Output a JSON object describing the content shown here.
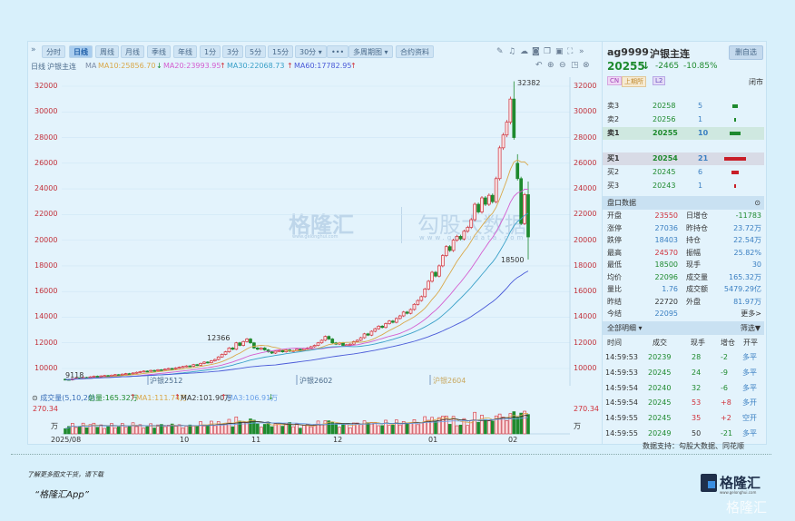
{
  "toolbar": {
    "collapse_icon": "double-chevron-right",
    "tabs": [
      "分时",
      "日线",
      "周线",
      "月线",
      "季线",
      "年线",
      "1分",
      "3分",
      "5分",
      "15分",
      "30分 ▾",
      "•••",
      "多周期图 ▾",
      "合约资料"
    ],
    "active_tab": "日线",
    "icons": [
      "pencil-icon",
      "bell-icon",
      "cloud-icon",
      "camera-icon",
      "copy-icon",
      "monitor-icon",
      "fullscreen-icon",
      "double-chevron-right-icon"
    ],
    "icons2": [
      "undo-icon",
      "zoom-in-icon",
      "zoom-out-icon",
      "window-icon",
      "close-circle-icon"
    ]
  },
  "ma_line": {
    "period": "日线",
    "name": "沪银主连",
    "ma": "MA",
    "ma10": "MA10:25856.70",
    "ma10_arrow": "↓",
    "ma20": "MA20:23993.95",
    "ma20_arrow": "↑",
    "ma30": "MA30:22068.73",
    "ma30_arrow": "↑",
    "ma60": "MA60:17782.95",
    "ma60_arrow": "↑"
  },
  "colors": {
    "up": "#d0303a",
    "down": "#1e8a2e",
    "ma10": "#d9a84a",
    "ma20": "#d45ed0",
    "ma30": "#3aa0c8",
    "ma60": "#4a5ad8"
  },
  "price_axis": [
    "32000",
    "30000",
    "28000",
    "26000",
    "24000",
    "22000",
    "20000",
    "18000",
    "16000",
    "14000",
    "12000",
    "10000"
  ],
  "annotations": {
    "high": "32382",
    "low": "18500",
    "local_high": "12366",
    "start_low": "9118"
  },
  "contracts": [
    "沪银2512",
    "沪银2602",
    "沪银2604"
  ],
  "watermark": {
    "brand1": "格隆汇",
    "url1": "www.gelonghui.com",
    "brand2": "勾股大数据",
    "url2": "www.gogudata.com"
  },
  "volume": {
    "label": "成交量(5,10,20)",
    "total": "总量:165.32万",
    "total_arrow": "↑",
    "ma1": "MA1:111.74万",
    "ma1_arrow": "↑",
    "ma2": "MA2:101.90万",
    "ma2_arrow": "↑",
    "ma3": "MA3:106.91万",
    "ma3_arrow": "↓",
    "max": "270.34",
    "unit": "万"
  },
  "months": [
    "2025/08",
    "10",
    "11",
    "12",
    "01",
    "02"
  ],
  "chart_data": {
    "type": "candlestick",
    "closes": [
      9150,
      9118,
      9200,
      9250,
      9230,
      9300,
      9280,
      9350,
      9400,
      9380,
      9420,
      9450,
      9400,
      9480,
      9520,
      9500,
      9560,
      9600,
      9580,
      9650,
      9700,
      9750,
      9800,
      9780,
      9850,
      9820,
      9900,
      9880,
      9950,
      10000,
      9980,
      10050,
      10100,
      10150,
      10200,
      10180,
      10300,
      10250,
      10400,
      10500,
      10450,
      10600,
      10700,
      10900,
      11100,
      11300,
      11600,
      11500,
      12000,
      11800,
      12100,
      12300,
      12000,
      11600,
      11500,
      11600,
      11450,
      11300,
      11200,
      11350,
      11400,
      11300,
      11450,
      11350,
      11400,
      11500,
      11450,
      11550,
      11600,
      11700,
      11800,
      12000,
      12200,
      12500,
      12300,
      12000,
      11900,
      12000,
      11800,
      11850,
      11900,
      12100,
      12200,
      12400,
      12700,
      12600,
      12900,
      13100,
      13300,
      13200,
      13500,
      13700,
      13600,
      13900,
      14100,
      14400,
      14300,
      14600,
      15000,
      15300,
      15600,
      16200,
      16800,
      17500,
      17200,
      18000,
      18800,
      19500,
      19200,
      20000,
      20300,
      20100,
      20700,
      21000,
      21600,
      22800,
      22200,
      23300,
      22800,
      23500,
      23000,
      24800,
      27200,
      28200,
      29200,
      31000,
      28000,
      24800,
      21300,
      23550,
      20255
    ],
    "last_candle": {
      "open": 23550,
      "high": 24570,
      "low": 18500,
      "close": 20255
    },
    "peak_high": 32382,
    "ylim": [
      9118,
      32382
    ]
  },
  "quote": {
    "code": "ag9999",
    "name": "沪银主连",
    "add_button": "删自选",
    "price": "20255",
    "arrow": "↓",
    "change": "-2465",
    "pct": "-10.85%",
    "tags": [
      "CN",
      "上期所",
      "L2"
    ],
    "status": "闭市"
  },
  "orderbook": [
    {
      "label": "卖3",
      "price": "20258",
      "vol": "5",
      "bar": 0.25,
      "side": "sell"
    },
    {
      "label": "卖2",
      "price": "20256",
      "vol": "1",
      "bar": 0.05,
      "side": "sell"
    },
    {
      "label": "卖1",
      "price": "20255",
      "vol": "10",
      "bar": 0.5,
      "side": "sell"
    },
    {
      "label": "买1",
      "price": "20254",
      "vol": "21",
      "bar": 1,
      "side": "buy"
    },
    {
      "label": "买2",
      "price": "20245",
      "vol": "6",
      "bar": 0.3,
      "side": "buy"
    },
    {
      "label": "买3",
      "price": "20243",
      "vol": "1",
      "bar": 0.05,
      "side": "buy"
    }
  ],
  "stats": {
    "title": "盘口数据",
    "rows": [
      [
        "开盘",
        "23550",
        "r",
        "日增仓",
        "-11783",
        "g"
      ],
      [
        "涨停",
        "27036",
        "b",
        "昨持仓",
        "23.72万",
        "b"
      ],
      [
        "跌停",
        "18403",
        "b",
        "持仓",
        "22.54万",
        "b"
      ],
      [
        "最高",
        "24570",
        "r",
        "振幅",
        "25.82%",
        "b"
      ],
      [
        "最低",
        "18500",
        "g",
        "现手",
        "30",
        "b"
      ],
      [
        "均价",
        "22096",
        "g",
        "成交量",
        "165.32万",
        "b"
      ],
      [
        "量比",
        "1.76",
        "b",
        "成交额",
        "5479.29亿",
        "b"
      ],
      [
        "昨结",
        "22720",
        "k",
        "外盘",
        "81.97万",
        "b"
      ],
      [
        "今结",
        "22095",
        "b",
        "",
        "更多>",
        "k"
      ]
    ]
  },
  "details": {
    "title": "全部明细 ▾",
    "filter": "筛选▼",
    "columns": [
      "时间",
      "成交",
      "现手",
      "增仓",
      "开平"
    ],
    "rows": [
      [
        "14:59:53",
        "20239",
        "28",
        "-2",
        "多平"
      ],
      [
        "14:59:53",
        "20245",
        "24",
        "-9",
        "多平"
      ],
      [
        "14:59:54",
        "20240",
        "32",
        "-6",
        "多平"
      ],
      [
        "14:59:54",
        "20245",
        "53",
        "+8",
        "多开"
      ],
      [
        "14:59:55",
        "20245",
        "35",
        "+2",
        "空开"
      ],
      [
        "14:59:55",
        "20249",
        "50",
        "-21",
        "多平"
      ]
    ]
  },
  "source": "数据支持：勾股大数据、同花顺",
  "footer": {
    "line1": "了解更多图文干货，请下载",
    "line2": "“格隆汇App”",
    "logo": "格隆汇",
    "logo_url": "www.gelonghui.com"
  }
}
